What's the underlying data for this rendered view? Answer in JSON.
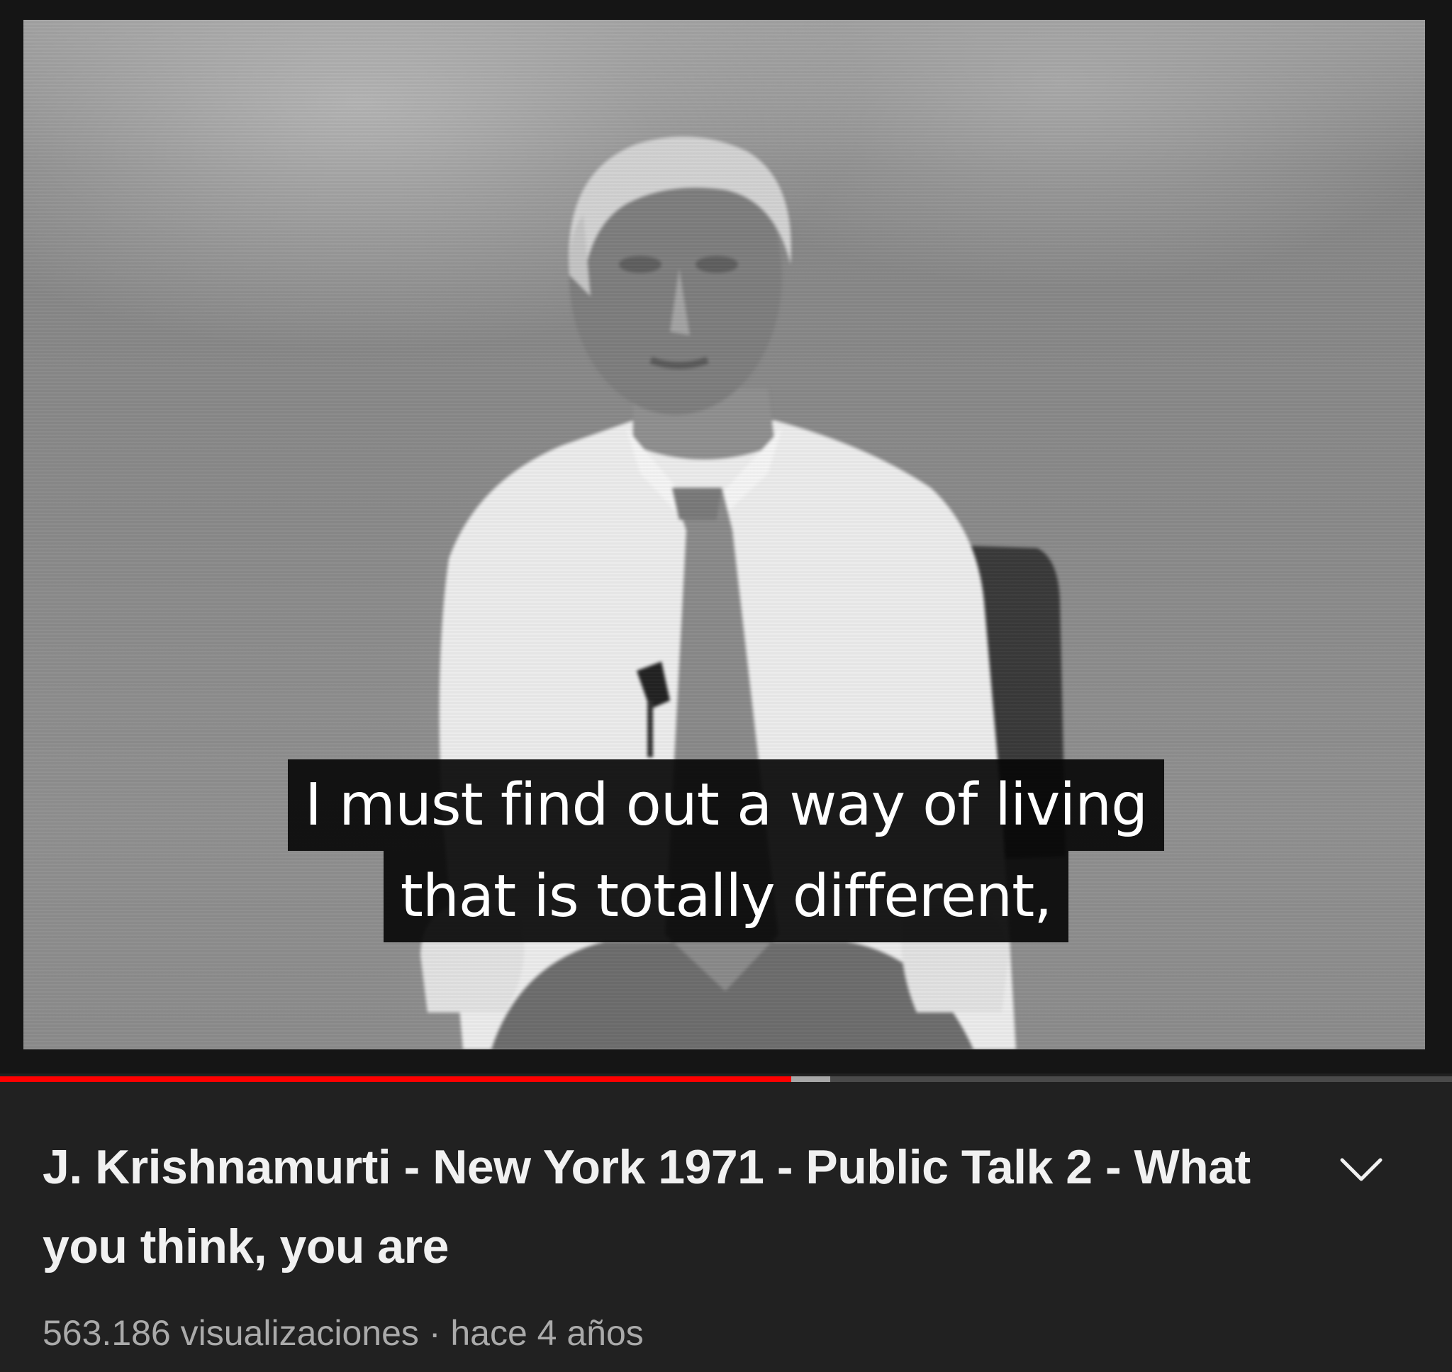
{
  "video": {
    "captions": [
      "I must find out a way of living",
      "that is totally different,"
    ],
    "progress": {
      "played_fraction": 0.545,
      "buffered_fraction": 0.572,
      "colors": {
        "played": "#ff0000",
        "buffered": "#a7a7a7",
        "track": "#4a4a4a"
      }
    }
  },
  "info": {
    "title": "J. Krishnamurti - New York 1971 - Public Talk 2 - What you think, you are",
    "views": "563.186 visualizaciones",
    "separator": " · ",
    "age": "hace 4 años",
    "expand_icon": "chevron-down-icon"
  },
  "theme": {
    "background": "#212121",
    "title_color": "#f1f1f1",
    "meta_color": "#aaaaaa"
  }
}
